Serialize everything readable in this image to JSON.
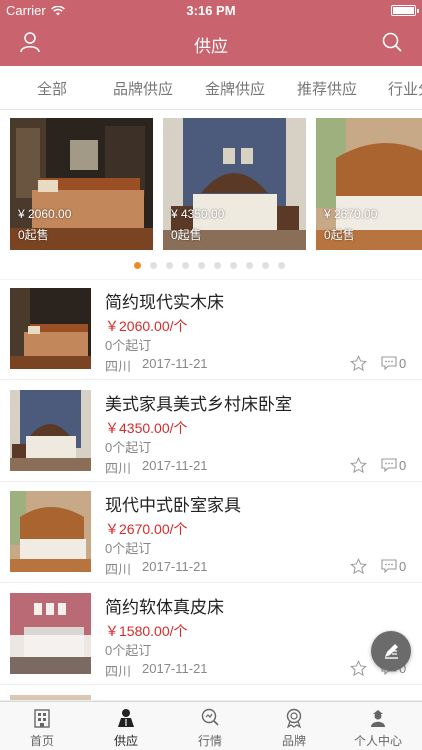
{
  "status_bar": {
    "carrier": "Carrier",
    "time": "3:16 PM"
  },
  "header": {
    "title": "供应",
    "user_icon": "user-icon",
    "search_icon": "search-icon"
  },
  "brand_color": "#c9636d",
  "price_color": "#d62b2b",
  "tabs": [
    {
      "label": "全部"
    },
    {
      "label": "品牌供应"
    },
    {
      "label": "金牌供应"
    },
    {
      "label": "推荐供应"
    },
    {
      "label": "行业分"
    }
  ],
  "carousel": {
    "slides": [
      {
        "price": "¥ 2060.00",
        "moq": "0起售"
      },
      {
        "price": "¥ 4350.00",
        "moq": "0起售"
      },
      {
        "price": "¥ 2670.00",
        "moq": "0起售"
      }
    ],
    "dot_count": 10,
    "active_dot": 0
  },
  "products": [
    {
      "name": "简约现代实木床",
      "price": "￥2060.00/个",
      "moq": "0个起订",
      "region": "四川",
      "date": "2017-11-21",
      "comments": "0"
    },
    {
      "name": "美式家具美式乡村床卧室",
      "price": "￥4350.00/个",
      "moq": "0个起订",
      "region": "四川",
      "date": "2017-11-21",
      "comments": "0"
    },
    {
      "name": "现代中式卧室家具",
      "price": "￥2670.00/个",
      "moq": "0个起订",
      "region": "四川",
      "date": "2017-11-21",
      "comments": "0"
    },
    {
      "name": "简约软体真皮床",
      "price": "￥1580.00/个",
      "moq": "0个起订",
      "region": "四川",
      "date": "2017-11-21",
      "comments": "0"
    }
  ],
  "bottom_nav": [
    {
      "label": "首页",
      "icon": "home-icon"
    },
    {
      "label": "供应",
      "icon": "supply-icon",
      "active": true
    },
    {
      "label": "行情",
      "icon": "market-icon"
    },
    {
      "label": "品牌",
      "icon": "brand-icon"
    },
    {
      "label": "个人中心",
      "icon": "profile-icon"
    }
  ],
  "fab_icon": "edit-icon"
}
